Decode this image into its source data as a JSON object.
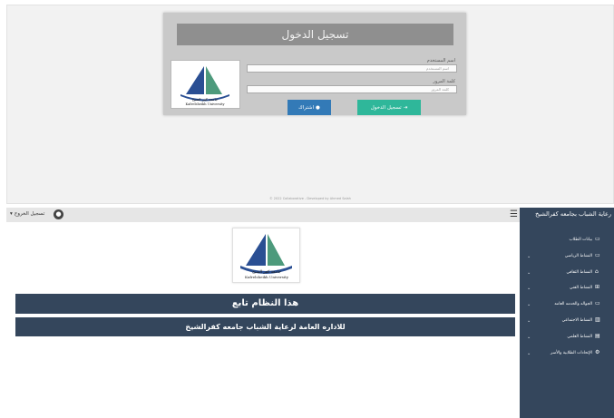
{
  "colors": {
    "navy": "#34465c",
    "login_button": "#2fb79a",
    "register_button": "#337ab7",
    "panel": "#c9c9c9"
  },
  "login": {
    "title": "تسجيل الدخول",
    "username_label": "اسم المستخدم",
    "username_placeholder": "اسم المستخدم",
    "password_label": "كلمة المرور",
    "password_placeholder": "كلمة المرور",
    "login_button": "تسجيل الدخول",
    "register_button": "اشتراك",
    "footer": "© 2022 Collaborative - Developed by Ahmed Salah"
  },
  "logo": {
    "arabic": "جامعة كفر الشيخ",
    "english": "Kafrelsheikh University"
  },
  "header": {
    "logout_label": "تسجيل الخروج",
    "caret": "▾",
    "user_icon": "user-circle-icon",
    "menu_icon": "hamburger-icon"
  },
  "sidebar": {
    "title": "رعاية الشباب بجامعه كفرالشيخ",
    "items": [
      {
        "label": "بيانات الطلاب",
        "icon": "laptop-icon",
        "glyph": "▭",
        "chevron": ""
      },
      {
        "label": "النشاط الرياضي",
        "icon": "laptop-icon",
        "glyph": "▭",
        "chevron": "⌄"
      },
      {
        "label": "النشاط الثقافي",
        "icon": "home-icon",
        "glyph": "⌂",
        "chevron": "⌄"
      },
      {
        "label": "النشاط الفني",
        "icon": "sitemap-icon",
        "glyph": "⊞",
        "chevron": "⌄"
      },
      {
        "label": "الجواله والخدمه العامه",
        "icon": "desktop-icon",
        "glyph": "▭",
        "chevron": "⌄"
      },
      {
        "label": "النشاط الاجتماعي",
        "icon": "building-icon",
        "glyph": "▥",
        "chevron": "⌄"
      },
      {
        "label": "النشاط العلمي",
        "icon": "bar-chart-icon",
        "glyph": "▤",
        "chevron": "⌄"
      },
      {
        "label": "الإتحادات الطلابية والأسر",
        "icon": "cogs-icon",
        "glyph": "⚙",
        "chevron": "⌄"
      }
    ]
  },
  "main": {
    "banner_title": "هذا النظام تابع",
    "banner_subtitle": "للاداره العامة لرعاية الشباب جامعه كفرالشيخ"
  }
}
